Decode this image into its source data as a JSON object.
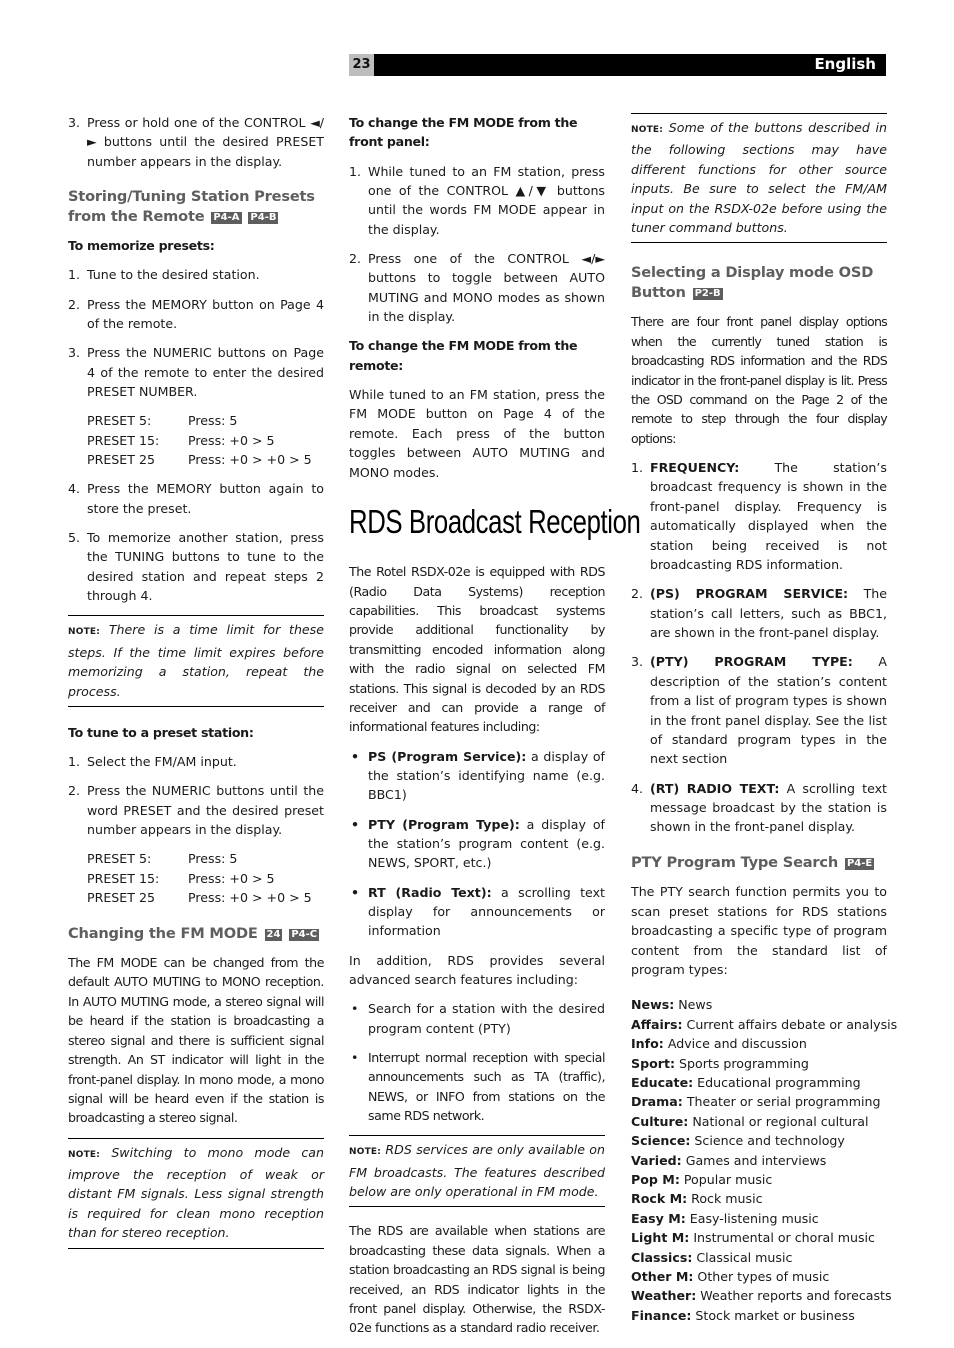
{
  "header": {
    "page_number": "23",
    "language": "English"
  },
  "col1": {
    "step3_num": "3.",
    "step3_text": "Press or hold one of the CONTROL ◄/► buttons until the desired PRESET number appears in the display.",
    "h_storing": "Storing/Tuning Station Presets from the Remote",
    "h_storing_tags": [
      "P4-A",
      "P4-B"
    ],
    "memorize_title": "To memorize presets:",
    "memorize_steps": [
      {
        "num": "1.",
        "text": "Tune to the desired station."
      },
      {
        "num": "2.",
        "text": "Press the MEMORY button on Page 4 of the remote."
      },
      {
        "num": "3.",
        "text": "Press the NUMERIC buttons on Page 4 of the remote to enter the desired PRESET NUMBER."
      }
    ],
    "presets_a": [
      {
        "k": "PRESET 5:",
        "v": "Press: 5"
      },
      {
        "k": "PRESET 15:",
        "v": "Press: +0 > 5"
      },
      {
        "k": "PRESET 25",
        "v": "Press: +0 > +0 > 5"
      }
    ],
    "memorize_steps_b": [
      {
        "num": "4.",
        "text": "Press the MEMORY button again to store the preset."
      },
      {
        "num": "5.",
        "text": "To memorize another station, press the TUNING buttons to tune to the desired station and repeat steps 2 through 4."
      }
    ],
    "note1_label": "NOTE:",
    "note1_text": "There is a time limit for these steps. If the time limit expires before memorizing a station, repeat the process.",
    "tune_title": "To tune to a preset station:",
    "tune_steps": [
      {
        "num": "1.",
        "text": "Select the FM/AM input."
      },
      {
        "num": "2.",
        "text": "Press the NUMERIC buttons until the word PRESET and the desired preset number appears in the display."
      }
    ],
    "presets_b": [
      {
        "k": "PRESET 5:",
        "v": "Press: 5"
      },
      {
        "k": "PRESET 15:",
        "v": "Press: +0 > 5"
      },
      {
        "k": "PRESET 25",
        "v": "Press: +0 > +0 > 5"
      }
    ],
    "h_fm": "Changing the FM MODE",
    "h_fm_tags": [
      "24",
      "P4-C"
    ],
    "fm_para": "The FM MODE can be changed from the default AUTO MUTING to MONO reception. In AUTO MUTING mode, a stereo signal will be heard if the station is broadcasting a stereo signal and there is sufficient signal strength. An ST indicator will light in the front-panel display. In mono mode, a mono signal will be heard even if the station is broadcasting a stereo signal.",
    "note2_label": "NOTE:",
    "note2_text": "Switching to mono mode can improve the reception of weak or distant FM signals. Less signal strength is required for clean mono reception than for stereo reception."
  },
  "col2": {
    "front_title": "To change the FM MODE from the front panel:",
    "front_steps": [
      {
        "num": "1.",
        "text": "While tuned to an FM station, press one of the CONTROL ▲/▼ buttons until the words FM MODE appear in the display."
      },
      {
        "num": "2.",
        "text": "Press one of the CONTROL ◄/► buttons to toggle between AUTO MUTING and MONO modes as shown in the display."
      }
    ],
    "remote_title": "To change the FM MODE from the remote:",
    "remote_para": "While tuned to an FM station, press the FM MODE button on Page 4 of the remote. Each press of the button toggles between AUTO MUTING and MONO modes.",
    "rds_title": "RDS Broadcast Reception",
    "rds_para": "The Rotel RSDX-02e is equipped with RDS (Radio Data Systems) reception capabilities. This broadcast systems provide additional functionality by transmitting encoded information along with the radio signal on selected FM stations. This signal is decoded by an RDS receiver and can provide a range of informational features including:",
    "features": [
      {
        "term": "PS (Program Service):",
        "text": "a display of the station’s identifying name (e.g. BBC1)"
      },
      {
        "term": "PTY (Program Type):",
        "text": "a display of the station’s program content (e.g. NEWS, SPORT, etc.)"
      },
      {
        "term": "RT (Radio Text):",
        "text": "a scrolling text display for announcements or information"
      }
    ],
    "advanced_para": "In addition, RDS provides several advanced search features including:",
    "search_features": [
      "Search for a station with the desired program content (PTY)",
      "Interrupt normal reception with special announcements such as TA (traffic), NEWS, or INFO from stations on the same RDS network."
    ],
    "note_label": "NOTE:",
    "note_text": "RDS services are only available on FM broadcasts. The features described below are only operational in FM mode.",
    "avail_para": "The RDS are available when stations are broadcasting these data signals. When a station broadcasting an RDS signal is being received, an RDS indicator lights in the front panel display. Otherwise, the RSDX-02e functions as a standard radio receiver."
  },
  "col3": {
    "note_label": "NOTE:",
    "note_text": "Some of the buttons described in the following sections may have different functions for other source inputs. Be sure to select the FM/AM input on the RSDX-02e before using the tuner command buttons.",
    "h_osd": "Selecting a Display mode OSD Button",
    "h_osd_tag": "P2-B",
    "osd_para": "There are four front panel display options when the currently tuned station is broadcasting RDS information and the RDS indicator in the front-panel display is lit. Press the OSD command on the Page 2 of the remote to step through the four display options:",
    "osd_steps": [
      {
        "num": "1.",
        "term": "FREQUENCY:",
        "text": "The station’s broadcast frequency is shown in the front-panel display. Frequency is automatically displayed when the station being received is not broadcasting RDS information."
      },
      {
        "num": "2.",
        "term": "(PS) PROGRAM SERVICE:",
        "text": "The station’s call letters, such as BBC1, are shown in the front-panel display."
      },
      {
        "num": "3.",
        "term": "(PTY) PROGRAM TYPE:",
        "text": "A description of the station’s content from a list of program types is shown in the front panel display. See the list of standard program types in the next section"
      },
      {
        "num": "4.",
        "term": "(RT) RADIO TEXT:",
        "text": "A scrolling text message broadcast by the station is shown in the front-panel display."
      }
    ],
    "h_pty": "PTY Program Type Search",
    "h_pty_tag": "P4-E",
    "pty_para": "The PTY search function permits you to scan preset stations for RDS stations broadcasting a specific type of program content from the standard list of program types:",
    "pty_list": [
      {
        "term": "News:",
        "desc": "News"
      },
      {
        "term": "Affairs:",
        "desc": "Current affairs debate or analysis"
      },
      {
        "term": "Info:",
        "desc": "Advice and discussion"
      },
      {
        "term": "Sport:",
        "desc": "Sports programming"
      },
      {
        "term": "Educate:",
        "desc": "Educational programming"
      },
      {
        "term": "Drama:",
        "desc": "Theater or serial programming"
      },
      {
        "term": "Culture:",
        "desc": "National or regional cultural"
      },
      {
        "term": "Science:",
        "desc": "Science and technology"
      },
      {
        "term": "Varied:",
        "desc": "Games and interviews"
      },
      {
        "term": "Pop M:",
        "desc": "Popular music"
      },
      {
        "term": "Rock M:",
        "desc": "Rock music"
      },
      {
        "term": "Easy M:",
        "desc": "Easy-listening music"
      },
      {
        "term": "Light M:",
        "desc": "Instrumental or choral music"
      },
      {
        "term": "Classics:",
        "desc": "Classical music"
      },
      {
        "term": "Other M:",
        "desc": "Other types of music"
      },
      {
        "term": "Weather:",
        "desc": "Weather reports and forecasts"
      },
      {
        "term": "Finance:",
        "desc": "Stock market or business"
      }
    ]
  }
}
